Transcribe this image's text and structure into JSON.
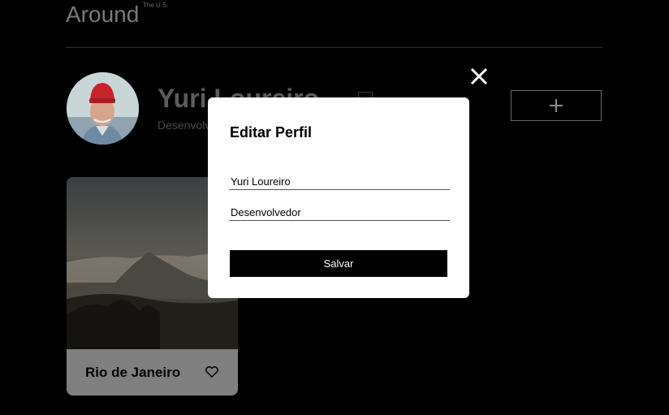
{
  "header": {
    "logo": "Around",
    "logo_superscript": "The U.S."
  },
  "profile": {
    "name": "Yuri Loureiro",
    "job": "Desenvolvedor",
    "add_icon": "plus-icon",
    "edit_icon": "pencil-icon"
  },
  "cards": [
    {
      "title": "Rio de Janeiro",
      "like_icon": "heart-icon"
    }
  ],
  "modal": {
    "title": "Editar Perfil",
    "name_value": "Yuri Loureiro",
    "job_value": "Desenvolvedor",
    "save_label": "Salvar",
    "close_icon": "close-icon"
  }
}
